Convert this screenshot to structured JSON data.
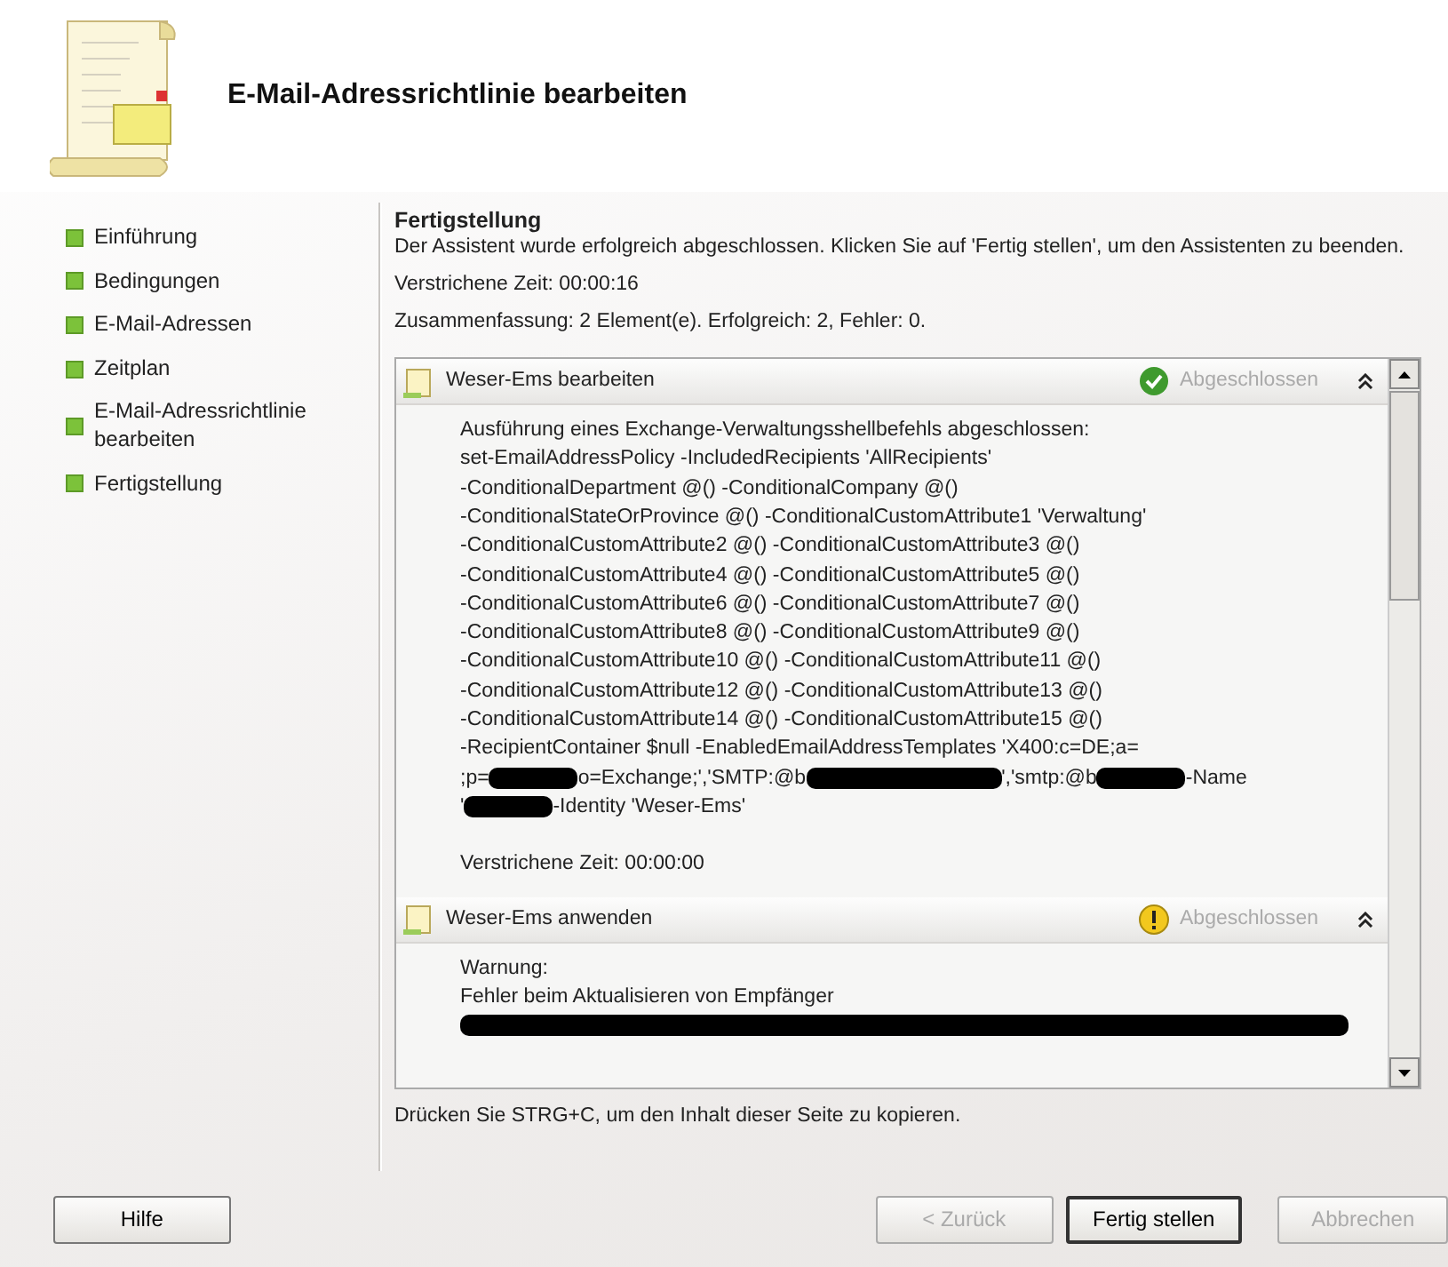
{
  "header": {
    "title": "E-Mail-Adressrichtlinie bearbeiten"
  },
  "steps": [
    {
      "label": "Einführung"
    },
    {
      "label": "Bedingungen"
    },
    {
      "label": "E-Mail-Adressen"
    },
    {
      "label": "Zeitplan"
    },
    {
      "label": "E-Mail-Adressrichtlinie bearbeiten"
    },
    {
      "label": "Fertigstellung"
    }
  ],
  "page": {
    "title": "Fertigstellung",
    "intro": "Der Assistent wurde erfolgreich abgeschlossen. Klicken Sie auf 'Fertig stellen', um den Assistenten zu beenden.",
    "elapsed": "Verstrichene Zeit: 00:00:16",
    "summary": "Zusammenfassung: 2 Element(e). Erfolgreich: 2, Fehler: 0."
  },
  "tasks": [
    {
      "title": "Weser-Ems bearbeiten",
      "kind": "success",
      "status": "Abgeschlossen",
      "lines": [
        [
          {
            "text": "Ausführung eines Exchange-Verwaltungsshellbefehls abgeschlossen:"
          }
        ],
        [
          {
            "text": "set-EmailAddressPolicy -IncludedRecipients 'AllRecipients'"
          }
        ],
        [
          {
            "text": "-ConditionalDepartment @() -ConditionalCompany @()"
          }
        ],
        [
          {
            "text": "-ConditionalStateOrProvince @() -ConditionalCustomAttribute1 'Verwaltung'"
          }
        ],
        [
          {
            "text": "-ConditionalCustomAttribute2 @() -ConditionalCustomAttribute3 @()"
          }
        ],
        [
          {
            "text": "-ConditionalCustomAttribute4 @() -ConditionalCustomAttribute5 @()"
          }
        ],
        [
          {
            "text": "-ConditionalCustomAttribute6 @() -ConditionalCustomAttribute7 @()"
          }
        ],
        [
          {
            "text": "-ConditionalCustomAttribute8 @() -ConditionalCustomAttribute9 @()"
          }
        ],
        [
          {
            "text": "-ConditionalCustomAttribute10 @() -ConditionalCustomAttribute11 @()"
          }
        ],
        [
          {
            "text": "-ConditionalCustomAttribute12 @() -ConditionalCustomAttribute13 @()"
          }
        ],
        [
          {
            "text": "-ConditionalCustomAttribute14 @() -ConditionalCustomAttribute15 @()"
          }
        ],
        [
          {
            "text": "-RecipientContainer $null -EnabledEmailAddressTemplates 'X400:c=DE;a="
          }
        ],
        [
          {
            "text": ";p="
          },
          {
            "kind": "redacted_short"
          },
          {
            "text": "o=Exchange;','SMTP:@b"
          },
          {
            "kind": "redacted_long"
          },
          {
            "text": "','smtp:@b"
          },
          {
            "kind": "redacted_short"
          },
          {
            "text": "-Name"
          }
        ],
        [
          {
            "text": "'"
          },
          {
            "kind": "redacted_short"
          },
          {
            "text": "-Identity 'Weser-Ems'"
          }
        ]
      ],
      "elapsed": "Verstrichene Zeit: 00:00:00"
    },
    {
      "title": "Weser-Ems anwenden",
      "kind": "warning",
      "status": "Abgeschlossen",
      "lines": [
        [
          {
            "text": "Warnung:"
          }
        ],
        [
          {
            "text": "Fehler beim Aktualisieren von Empfänger"
          }
        ],
        [
          {
            "kind": "redacted_line"
          }
        ]
      ]
    }
  ],
  "hint": "Drücken Sie STRG+C, um den Inhalt dieser Seite zu kopieren.",
  "buttons": [
    {
      "label": "Hilfe",
      "disabled": false,
      "default": false
    },
    {
      "label": "< Zurück",
      "disabled": true,
      "default": false
    },
    {
      "label": "Fertig stellen",
      "disabled": false,
      "default": true
    },
    {
      "label": "Abbrechen",
      "disabled": true,
      "default": false
    }
  ]
}
